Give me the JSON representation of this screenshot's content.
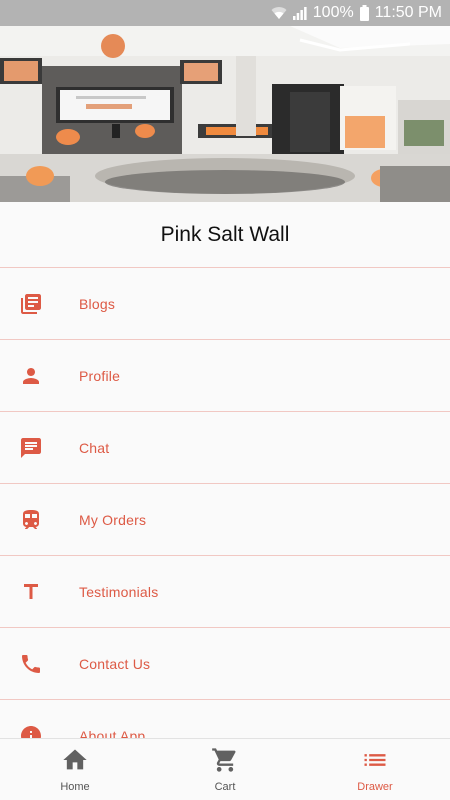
{
  "status_bar": {
    "battery": "100%",
    "time": "11:50 PM"
  },
  "header": {
    "title": "Pink Salt Wall"
  },
  "menu": {
    "items": [
      {
        "label": "Blogs",
        "icon": "blog-icon"
      },
      {
        "label": "Profile",
        "icon": "person-icon"
      },
      {
        "label": "Chat",
        "icon": "chat-icon"
      },
      {
        "label": "My Orders",
        "icon": "train-icon"
      },
      {
        "label": "Testimonials",
        "icon": "text-icon"
      },
      {
        "label": "Contact Us",
        "icon": "phone-icon"
      },
      {
        "label": "About App",
        "icon": "info-icon"
      }
    ]
  },
  "bottom_nav": {
    "home": "Home",
    "cart": "Cart",
    "drawer": "Drawer"
  },
  "colors": {
    "accent": "#dd5a45",
    "divider": "#f1c8c3",
    "icon_gray": "#616161"
  }
}
